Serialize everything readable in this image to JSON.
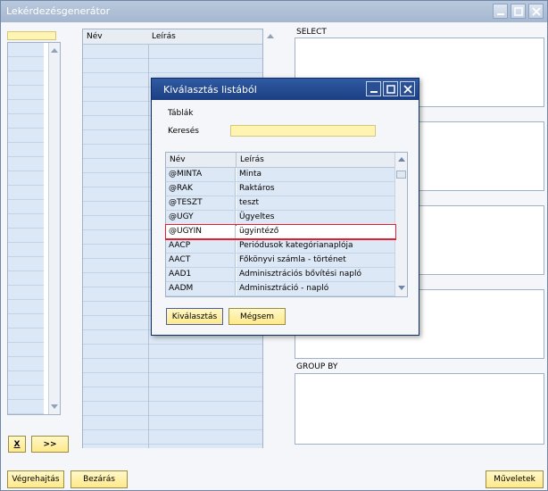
{
  "window": {
    "title": "Lekérdezésgenerátor"
  },
  "table_main": {
    "col_name": "Név",
    "col_desc": "Leírás"
  },
  "sections": {
    "select": "SELECT",
    "group_by": "GROUP BY"
  },
  "left_buttons": {
    "clear": "X",
    "add": ">>"
  },
  "bottom_buttons": {
    "execute": "Végrehajtás",
    "close": "Bezárás",
    "operations": "Műveletek"
  },
  "dialog": {
    "title": "Kiválasztás listából",
    "tables_label": "Táblák",
    "search_label": "Keresés",
    "search_value": "",
    "col_name": "Név",
    "col_desc": "Leírás",
    "rows": [
      {
        "name": "@MINTA",
        "desc": "Minta"
      },
      {
        "name": "@RAK",
        "desc": "Raktáros"
      },
      {
        "name": "@TESZT",
        "desc": "teszt"
      },
      {
        "name": "@UGY",
        "desc": "Ügyeltes"
      },
      {
        "name": "@UGYIN",
        "desc": "ügyintéző"
      },
      {
        "name": "AACP",
        "desc": "Periódusok kategórianaplója"
      },
      {
        "name": "AACT",
        "desc": "Főkönyvi számla - történet"
      },
      {
        "name": "AAD1",
        "desc": "Adminisztrációs bővítési napló"
      },
      {
        "name": "AADM",
        "desc": "Adminisztráció - napló"
      }
    ],
    "selected_index": 4,
    "select_button": "Kiválasztás",
    "cancel_button": "Mégsem"
  },
  "colors": {
    "accent_input": "#fff4b0",
    "dialog_titlebar": "#1c3f82",
    "selection_border": "#e0202e"
  }
}
